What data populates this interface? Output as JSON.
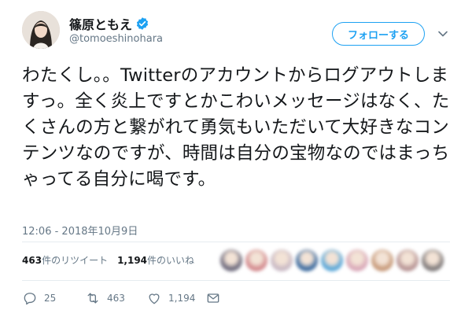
{
  "user": {
    "display_name": "篠原ともえ",
    "handle": "@tomoeshinohara",
    "verified": true
  },
  "header": {
    "follow_label": "フォローする"
  },
  "tweet": {
    "text": "わたくし。。Twitterのアカウントからログアウトしますっ。全く炎上ですとかこわいメッセージはなく、たくさんの方と繋がれて勇気もいただいて大好きなコンテンツなのですが、時間は自分の宝物なのではまっちゃってる自分に喝です。",
    "timestamp": "12:06 - 2018年10月9日"
  },
  "stats": {
    "retweets_count": "463",
    "retweets_label": "件のリツイート",
    "likes_count": "1,194",
    "likes_label": "件のいいね"
  },
  "actions": {
    "reply_count": "25",
    "retweet_count": "463",
    "like_count": "1,194"
  },
  "colors": {
    "accent": "#1da1f2",
    "muted": "#657786",
    "text": "#14171a"
  },
  "likers": [
    "#6e6a7c",
    "#d38a8e",
    "#c9b9c4",
    "#3d6b9f",
    "#5aa7d8",
    "#d9a8b8",
    "#c79a7a",
    "#b79494",
    "#7f7a7a"
  ]
}
